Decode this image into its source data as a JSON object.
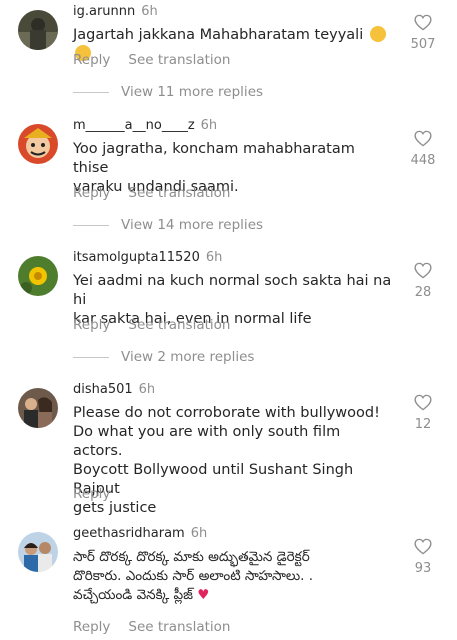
{
  "comments": [
    {
      "username": "ig.arunnn",
      "time": "6h",
      "text": "Jagartah jakkana Mahabharatam teyyali",
      "emoji": [
        "sleepy-face",
        "slight-smile"
      ],
      "reply": "Reply",
      "see_translation": "See translation",
      "likes": "507",
      "view_more": "View 11 more replies"
    },
    {
      "username": "m______a__no____z",
      "time": "6h",
      "text": "Yoo jagratha, koncham mahabharatam thise\nvaraku undandi saami.",
      "reply": "Reply",
      "see_translation": "See translation",
      "likes": "448",
      "view_more": "View 14 more replies"
    },
    {
      "username": "itsamolgupta11520",
      "time": "6h",
      "text": "Yei aadmi na kuch normal soch sakta hai na hi\nkar sakta hai, even in normal life",
      "reply": "Reply",
      "see_translation": "See translation",
      "likes": "28",
      "view_more": "View 2 more replies"
    },
    {
      "username": "disha501",
      "time": "6h",
      "text": "Please do not corroborate with bullywood!\nDo what you are with only south film actors.\nBoycott Bollywood until Sushant Singh Rajput\ngets justice",
      "reply": "Reply",
      "likes": "12"
    },
    {
      "username": "geethasridharam",
      "time": "6h",
      "text": "సార్ దొరక్క దొరక్క మాకు అద్భుతమైన డైరెక్టర్\nదొరికారు. ఎందుకు సార్ అలాంటి సాహసాలు. .\nవచ్చేయండి వెనక్కి ప్లీజ్",
      "emoji": [
        "red-heart"
      ],
      "reply": "Reply",
      "see_translation": "See translation",
      "likes": "93"
    }
  ]
}
